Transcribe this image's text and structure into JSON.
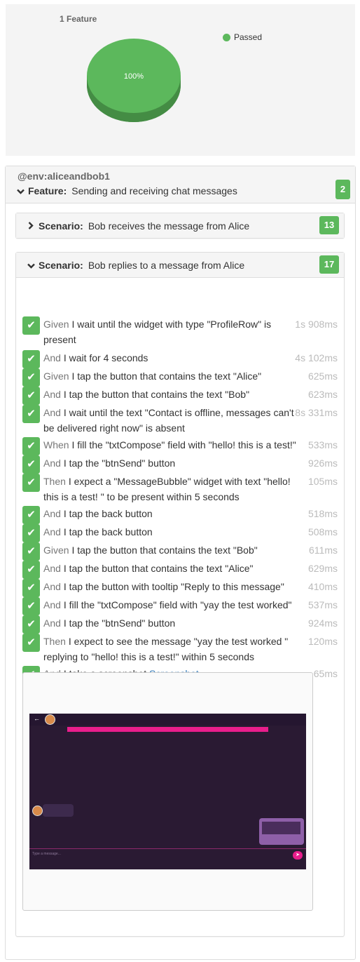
{
  "chart_data": {
    "type": "pie",
    "title": "1 Feature",
    "categories": [
      "Passed"
    ],
    "values": [
      100
    ],
    "data_labels": [
      "100%"
    ],
    "legend": [
      "Passed"
    ],
    "legend_position": "top-right",
    "colors": [
      "#5cb85c"
    ]
  },
  "feature": {
    "tag": "@env:aliceandbob1",
    "keyword": "Feature:",
    "name": "Sending and receiving chat messages",
    "badge": "2",
    "expanded": true
  },
  "scenarios": [
    {
      "keyword": "Scenario:",
      "name": "Bob receives the message from Alice",
      "badge": "13",
      "expanded": false
    },
    {
      "keyword": "Scenario:",
      "name": "Bob replies to a message from Alice",
      "badge": "17",
      "expanded": true
    }
  ],
  "steps": [
    {
      "keyword": "Given",
      "text": "I wait until the widget with type \"ProfileRow\" is present",
      "duration": "1s 908ms",
      "status": "passed"
    },
    {
      "keyword": "And",
      "text": "I wait for 4 seconds",
      "duration": "4s 102ms",
      "status": "passed"
    },
    {
      "keyword": "Given",
      "text": "I tap the button that contains the text \"Alice\"",
      "duration": "625ms",
      "status": "passed"
    },
    {
      "keyword": "And",
      "text": "I tap the button that contains the text \"Bob\"",
      "duration": "623ms",
      "status": "passed"
    },
    {
      "keyword": "And",
      "text": "I wait until the text \"Contact is offline, messages can't be delivered right now\" is absent",
      "duration": "8s 331ms",
      "status": "passed"
    },
    {
      "keyword": "When",
      "text": "I fill the \"txtCompose\" field with \"hello! this is a test!\"",
      "duration": "533ms",
      "status": "passed"
    },
    {
      "keyword": "And",
      "text": "I tap the \"btnSend\" button",
      "duration": "926ms",
      "status": "passed"
    },
    {
      "keyword": "Then",
      "text": "I expect a \"MessageBubble\" widget with text \"hello! this is a test! \" to be present within 5 seconds",
      "duration": "105ms",
      "status": "passed"
    },
    {
      "keyword": "And",
      "text": "I tap the back button",
      "duration": "518ms",
      "status": "passed"
    },
    {
      "keyword": "And",
      "text": "I tap the back button",
      "duration": "508ms",
      "status": "passed"
    },
    {
      "keyword": "Given",
      "text": "I tap the button that contains the text \"Bob\"",
      "duration": "611ms",
      "status": "passed"
    },
    {
      "keyword": "And",
      "text": "I tap the button that contains the text \"Alice\"",
      "duration": "629ms",
      "status": "passed"
    },
    {
      "keyword": "And",
      "text": "I tap the button with tooltip \"Reply to this message\"",
      "duration": "410ms",
      "status": "passed"
    },
    {
      "keyword": "And",
      "text": "I fill the \"txtCompose\" field with \"yay the test worked\"",
      "duration": "537ms",
      "status": "passed"
    },
    {
      "keyword": "And",
      "text": "I tap the \"btnSend\" button",
      "duration": "924ms",
      "status": "passed"
    },
    {
      "keyword": "Then",
      "text": "I expect to see the message \"yay the test worked \" replying to \"hello! this is a test!\" within 5 seconds",
      "duration": "120ms",
      "status": "passed"
    },
    {
      "keyword": "And",
      "text": "I take a screenshot",
      "link": "Screenshot -",
      "duration": "65ms",
      "status": "passed"
    }
  ],
  "screenshot": {
    "composer_placeholder": "Type a message..."
  }
}
